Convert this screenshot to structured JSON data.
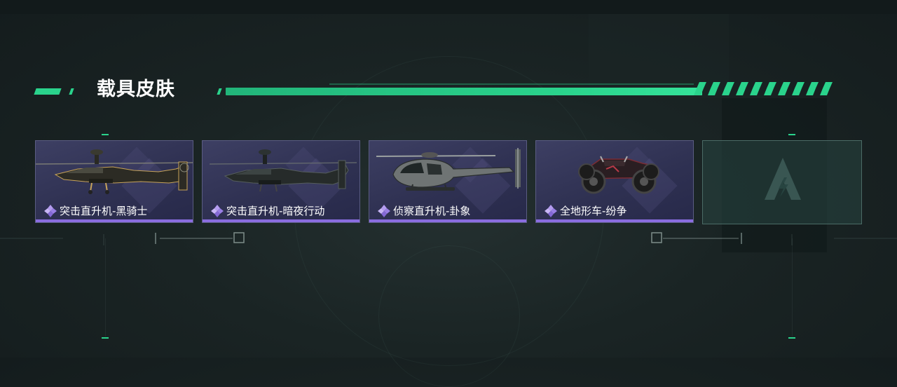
{
  "section": {
    "title": "载具皮肤"
  },
  "cards": [
    {
      "label": "突击直升机-黑骑士",
      "vehicle_icon": "attack-helicopter-icon",
      "rarity_color": "#8a6de0"
    },
    {
      "label": "突击直升机-暗夜行动",
      "vehicle_icon": "attack-helicopter-icon",
      "rarity_color": "#8a6de0"
    },
    {
      "label": "侦察直升机-卦象",
      "vehicle_icon": "scout-helicopter-icon",
      "rarity_color": "#8a6de0"
    },
    {
      "label": "全地形车-纷争",
      "vehicle_icon": "atv-icon",
      "rarity_color": "#8a6de0"
    }
  ],
  "empty_slot": {
    "icon": "game-logo-icon"
  },
  "colors": {
    "accent": "#2ad38c",
    "card_bg": "#2f3152",
    "rarity": "#8a6de0"
  }
}
